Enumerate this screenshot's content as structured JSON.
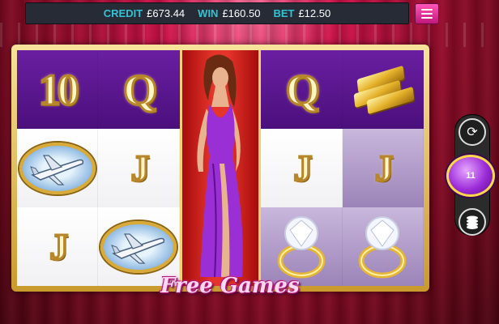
{
  "topbar": {
    "credit_label": "CREDIT",
    "credit_value": "£673.44",
    "win_label": "WIN",
    "win_value": "£160.50",
    "bet_label": "BET",
    "bet_value": "£12.50"
  },
  "reels": [
    [
      "10",
      "plane",
      "J"
    ],
    [
      "Q",
      "J",
      "plane"
    ],
    [
      "wild-woman"
    ],
    [
      "Q",
      "J",
      "ring"
    ],
    [
      "gold-bars",
      "J",
      "ring"
    ]
  ],
  "banner": "Free Games",
  "controls": {
    "spin_count": "11"
  },
  "colors": {
    "topbar_label": "#33c3d4",
    "menu": "#e52f9c",
    "spin": "#9c2cd8",
    "frame_gold": "#e2b64a"
  }
}
